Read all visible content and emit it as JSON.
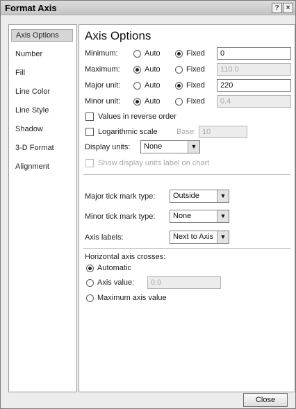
{
  "window": {
    "title": "Format Axis",
    "help_glyph": "?",
    "close_glyph": "×"
  },
  "nav": {
    "items": [
      "Axis Options",
      "Number",
      "Fill",
      "Line Color",
      "Line Style",
      "Shadow",
      "3-D Format",
      "Alignment"
    ],
    "selected": "Axis Options"
  },
  "panel": {
    "heading": "Axis Options",
    "rows": {
      "minimum": {
        "label": "Minimum:",
        "auto": "Auto",
        "fixed": "Fixed",
        "value": "0",
        "selected": "Fixed"
      },
      "maximum": {
        "label": "Maximum:",
        "auto": "Auto",
        "fixed": "Fixed",
        "value": "110.0",
        "selected": "Auto"
      },
      "major_unit": {
        "label": "Major unit:",
        "auto": "Auto",
        "fixed": "Fixed",
        "value": "220",
        "selected": "Fixed"
      },
      "minor_unit": {
        "label": "Minor unit:",
        "auto": "Auto",
        "fixed": "Fixed",
        "value": "0.4",
        "selected": "Auto"
      }
    },
    "values_in_reverse_order": {
      "label": "Values in reverse order",
      "checked": false
    },
    "logarithmic_scale": {
      "label": "Logarithmic scale",
      "checked": false,
      "base_label": "Base:",
      "base_value": "10"
    },
    "display_units": {
      "label": "Display units:",
      "value": "None"
    },
    "show_display_units_label": {
      "label": "Show display units label on chart",
      "checked": false,
      "enabled": false
    },
    "major_tick_mark_type": {
      "label": "Major tick mark type:",
      "value": "Outside"
    },
    "minor_tick_mark_type": {
      "label": "Minor tick mark type:",
      "value": "None"
    },
    "axis_labels": {
      "label": "Axis labels:",
      "value": "Next to Axis"
    },
    "horizontal_axis_crosses": {
      "label": "Horizontal axis crosses:",
      "automatic": "Automatic",
      "axis_value_label": "Axis value:",
      "axis_value": "0.0",
      "maximum_axis_value": "Maximum axis value",
      "selected": "Automatic"
    }
  },
  "footer": {
    "close_label": "Close"
  },
  "dropdown_arrow": "▼"
}
